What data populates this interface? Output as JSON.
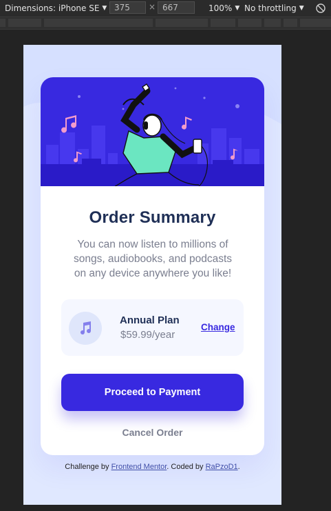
{
  "devtools": {
    "dimensions_label": "Dimensions: iPhone SE",
    "width_value": "375",
    "height_value": "667",
    "times_symbol": "×",
    "zoom_label": "100%",
    "throttle_label": "No throttling",
    "caret": "▼"
  },
  "card": {
    "title": "Order Summary",
    "description": "You can now listen to millions of songs, audiobooks, and podcasts on any device anywhere you like!",
    "plan": {
      "name": "Annual Plan",
      "price": "$59.99/year",
      "change_label": "Change",
      "icon": "music-note-icon"
    },
    "pay_button": "Proceed to Payment",
    "cancel_label": "Cancel Order"
  },
  "attribution": {
    "prefix": "Challenge by ",
    "mentor_link": "Frontend Mentor",
    "middle": ". Coded by ",
    "author_link": "RaPzoD1",
    "suffix": "."
  },
  "colors": {
    "primary": "#3829e0",
    "page_bg": "#e0e8ff",
    "heading": "#1f2f56",
    "muted": "#7a7e8f",
    "plan_bg": "#f5f7ff"
  }
}
